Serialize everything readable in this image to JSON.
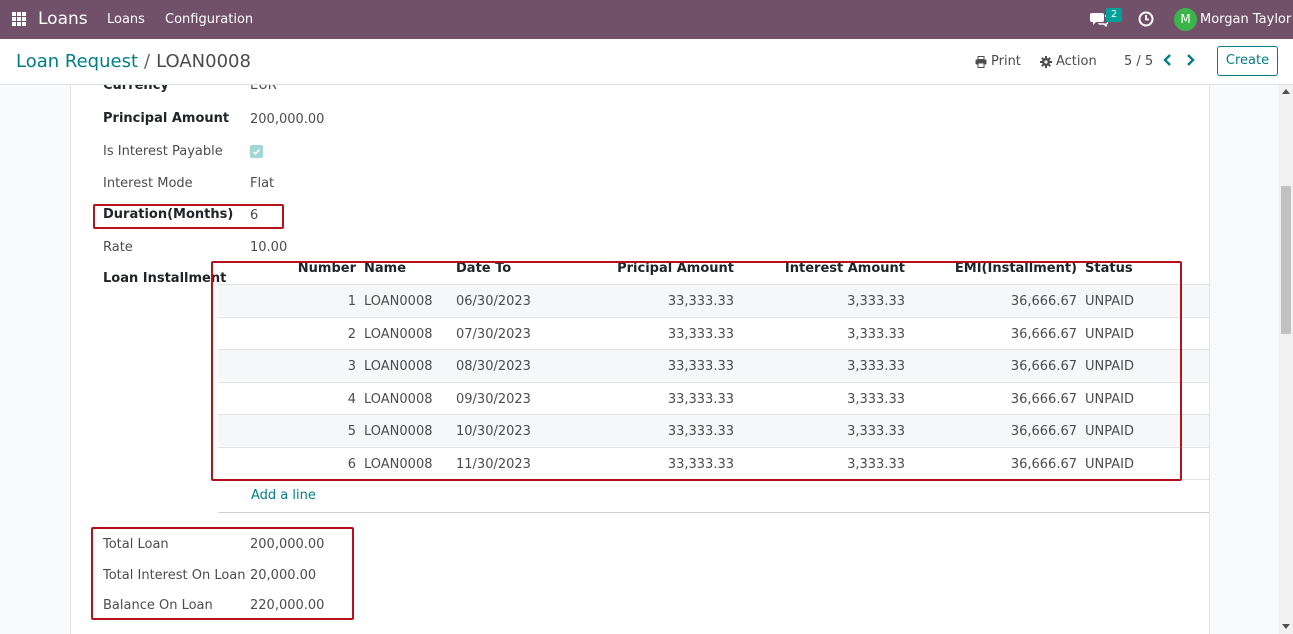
{
  "navbar": {
    "app_name": "Loans",
    "menu": [
      "Loans",
      "Configuration"
    ],
    "chat_count": "2",
    "user_initial": "M",
    "user_name": "Morgan Taylor"
  },
  "breadcrumb": {
    "parent": "Loan Request",
    "separator": "/",
    "current": "LOAN0008"
  },
  "toolbar": {
    "print_label": "Print",
    "action_label": "Action",
    "pager": "5 / 5",
    "create_label": "Create"
  },
  "form": {
    "currency": {
      "label": "Currency",
      "value": "EUR"
    },
    "principal_amount": {
      "label": "Principal Amount",
      "value": "200,000.00"
    },
    "is_interest_payable": {
      "label": "Is Interest Payable",
      "checked": true
    },
    "interest_mode": {
      "label": "Interest Mode",
      "value": "Flat"
    },
    "duration": {
      "label": "Duration(Months)",
      "value": "6"
    },
    "rate": {
      "label": "Rate",
      "value": "10.00"
    },
    "loan_installment_label": "Loan Installment"
  },
  "installments": {
    "columns": [
      "Number",
      "Name",
      "Date To",
      "Pricipal Amount",
      "Interest Amount",
      "EMI(Installment)",
      "Status"
    ],
    "rows": [
      [
        "1",
        "LOAN0008",
        "06/30/2023",
        "33,333.33",
        "3,333.33",
        "36,666.67",
        "UNPAID"
      ],
      [
        "2",
        "LOAN0008",
        "07/30/2023",
        "33,333.33",
        "3,333.33",
        "36,666.67",
        "UNPAID"
      ],
      [
        "3",
        "LOAN0008",
        "08/30/2023",
        "33,333.33",
        "3,333.33",
        "36,666.67",
        "UNPAID"
      ],
      [
        "4",
        "LOAN0008",
        "09/30/2023",
        "33,333.33",
        "3,333.33",
        "36,666.67",
        "UNPAID"
      ],
      [
        "5",
        "LOAN0008",
        "10/30/2023",
        "33,333.33",
        "3,333.33",
        "36,666.67",
        "UNPAID"
      ],
      [
        "6",
        "LOAN0008",
        "11/30/2023",
        "33,333.33",
        "3,333.33",
        "36,666.67",
        "UNPAID"
      ]
    ],
    "add_line": "Add a line"
  },
  "totals": {
    "total_loan": {
      "label": "Total Loan",
      "value": "200,000.00"
    },
    "total_interest": {
      "label": "Total Interest On Loan",
      "value": "20,000.00"
    },
    "balance": {
      "label": "Balance On Loan",
      "value": "220,000.00"
    }
  },
  "colors": {
    "navbar": "#71506a",
    "accent": "#017e84",
    "highlight": "#b5121b"
  }
}
